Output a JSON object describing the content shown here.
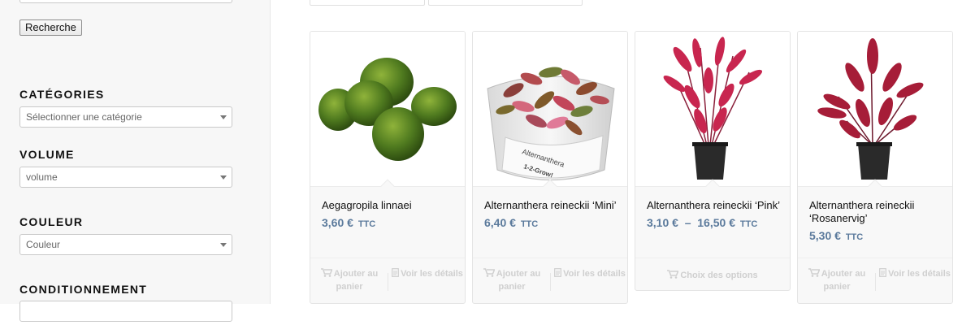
{
  "sidebar": {
    "search_button": "Recherche",
    "filters": [
      {
        "title": "CATÉGORIES",
        "value": "Sélectionner une catégorie"
      },
      {
        "title": "VOLUME",
        "value": "volume"
      },
      {
        "title": "COULEUR",
        "value": "Couleur"
      },
      {
        "title": "CONDITIONNEMENT",
        "value": ""
      }
    ]
  },
  "products": [
    {
      "name": "Aegagropila linnaei",
      "price": "3,60 €",
      "unit": "TTC",
      "action_left": "Ajouter au panier",
      "action_right": "Voir les détails"
    },
    {
      "name": "Alternanthera reineckii ‘Mini’",
      "price": "6,40 €",
      "unit": "TTC",
      "action_left": "Ajouter au panier",
      "action_right": "Voir les détails",
      "label_text": "Alternanthera",
      "label_sub": "1-2-Grow!"
    },
    {
      "name": "Alternanthera reineckii ‘Pink’",
      "price": "3,10 €  –  16,50 €",
      "unit": "TTC",
      "action_full": "Choix des options"
    },
    {
      "name": "Alternanthera reineckii ‘Rosanervig’",
      "price": "5,30 €",
      "unit": "TTC",
      "action_left": "Ajouter au panier",
      "action_right": "Voir les détails"
    }
  ],
  "colors": {
    "price": "#5b7a9c",
    "moss": "#4f7a1f",
    "plant_red": "#c8264f"
  }
}
